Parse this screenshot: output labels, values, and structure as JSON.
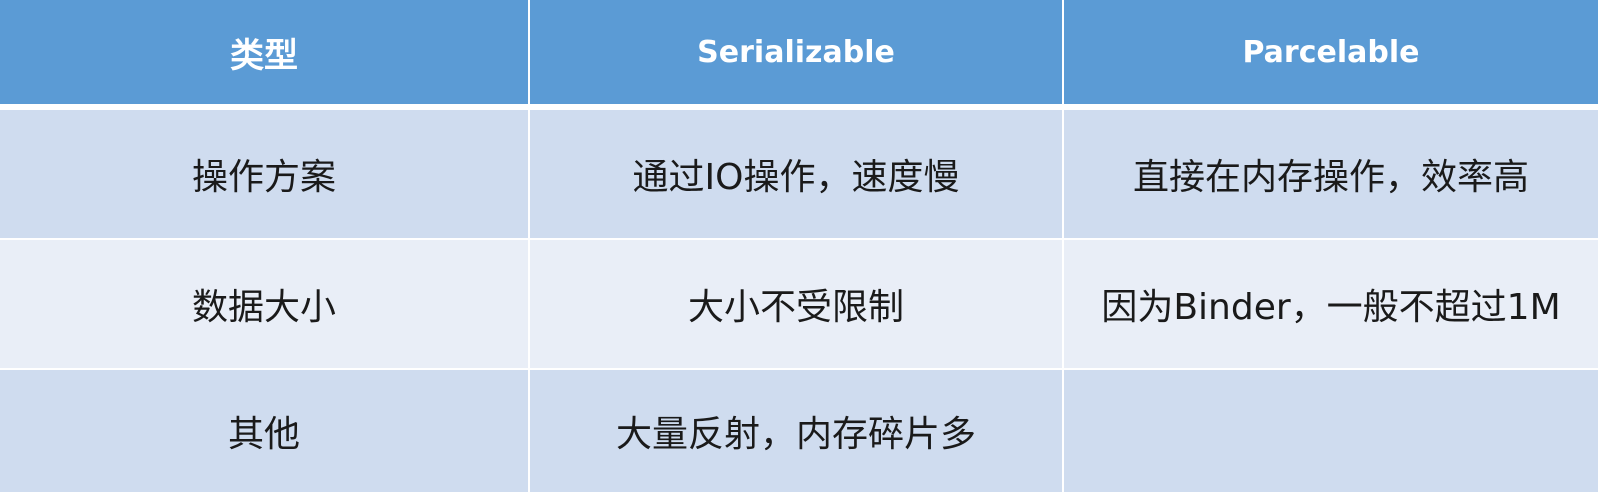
{
  "table": {
    "headers": [
      "类型",
      "Serializable",
      "Parcelable"
    ],
    "rows": [
      [
        "操作方案",
        "通过IO操作，速度慢",
        "直接在内存操作，效率高"
      ],
      [
        "数据大小",
        "大小不受限制",
        "因为Binder，一般不超过1M"
      ],
      [
        "其他",
        "大量反射，内存碎片多",
        ""
      ]
    ]
  },
  "colors": {
    "header_bg": "#5b9bd5",
    "row_dark": "#cfdcef",
    "row_light": "#e9eef7"
  }
}
